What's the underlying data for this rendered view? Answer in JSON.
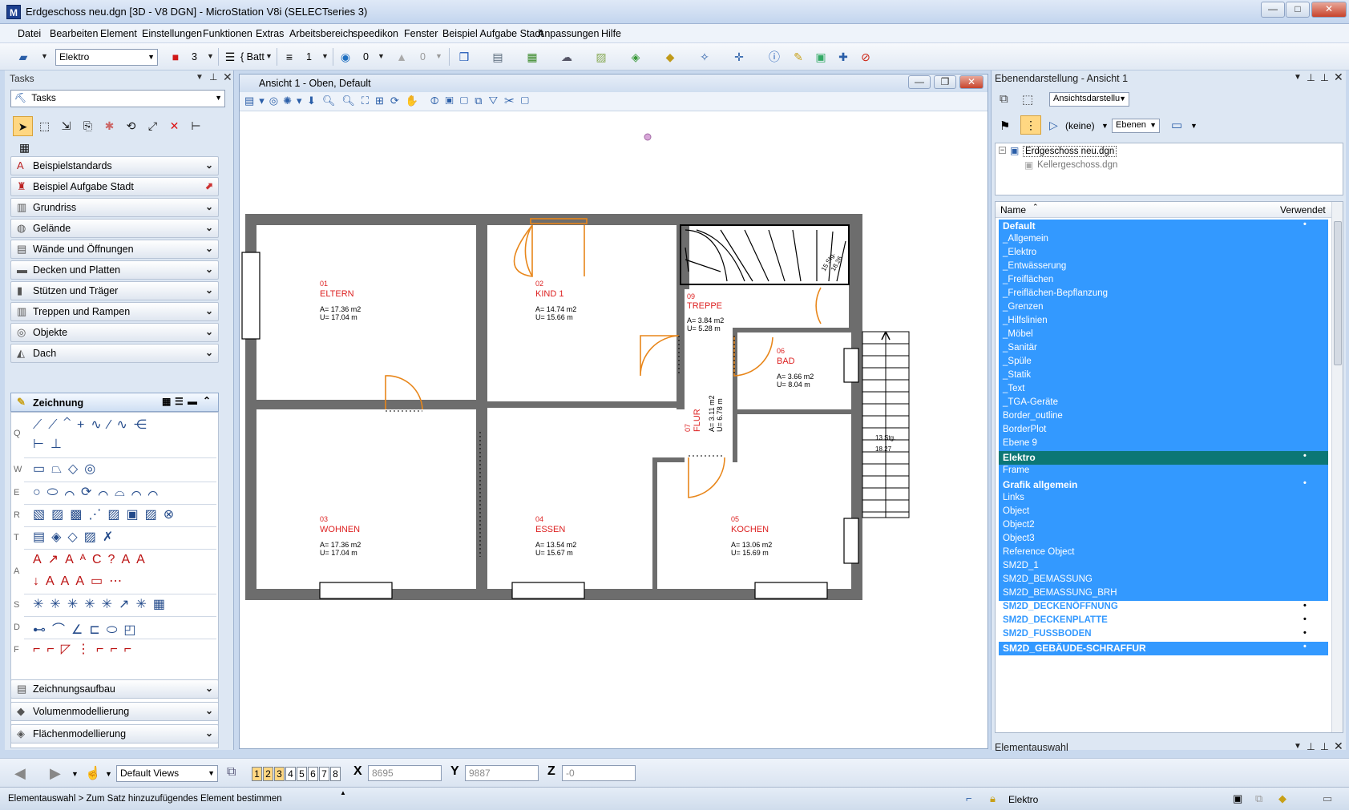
{
  "window": {
    "title": "Erdgeschoss neu.dgn [3D - V8 DGN] - MicroStation V8i (SELECTseries 3)",
    "app_icon": "M",
    "minimize": "—",
    "maximize": "□",
    "close": "✕"
  },
  "menu": [
    "Datei",
    "Bearbeiten",
    "Element",
    "Einstellungen",
    "Funktionen",
    "Extras",
    "Arbeitsbereich",
    "speedikon",
    "Fenster",
    "Beispiel Aufgabe Stadt",
    "Anpassungen",
    "Hilfe"
  ],
  "toolbar": {
    "level": "Elektro",
    "color": "3",
    "style": "{ Batt",
    "weight": "1",
    "transparency": "0",
    "priority": "0"
  },
  "tasks": {
    "title": "Tasks",
    "combo": "Tasks",
    "categories": [
      "Beispielstandards",
      "Beispiel Aufgabe Stadt",
      "Grundriss",
      "Gelände",
      "Wände und Öffnungen",
      "Decken und Platten",
      "Stützen und Träger",
      "Treppen und Rampen",
      "Objekte",
      "Dach"
    ],
    "active": "Zeichnung",
    "row_labels": [
      "Q",
      "W",
      "E",
      "R",
      "T",
      "A",
      "S",
      "D",
      "F"
    ],
    "bottom_categories": [
      "Zeichnungsaufbau",
      "Volumenmodellierung",
      "Flächenmodellierung"
    ]
  },
  "view": {
    "title": "Ansicht 1 - Oben, Default",
    "rooms": [
      {
        "num": "01",
        "name": "ELTERN",
        "area": "A= 17.36 m2",
        "perim": "U= 17.04 m"
      },
      {
        "num": "02",
        "name": "KIND 1",
        "area": "A= 14.74 m2",
        "perim": "U= 15.66 m"
      },
      {
        "num": "09",
        "name": "TREPPE",
        "area": "A= 3.84 m2",
        "perim": "U= 5.28 m"
      },
      {
        "num": "06",
        "name": "BAD",
        "area": "A= 3.66 m2",
        "perim": "U= 8.04 m"
      },
      {
        "num": "07",
        "name": "FLUR",
        "area": "A= 3.11 m2",
        "perim": "U= 6.78 m"
      },
      {
        "num": "03",
        "name": "WOHNEN",
        "area": "A= 17.36 m2",
        "perim": "U= 17.04 m"
      },
      {
        "num": "04",
        "name": "ESSEN",
        "area": "A= 13.54 m2",
        "perim": "U= 15.67 m"
      },
      {
        "num": "05",
        "name": "KOCHEN",
        "area": "A= 13.06 m2",
        "perim": "U= 15.69 m"
      }
    ],
    "stair_labels": [
      "13 Stg.",
      "18.27",
      "15 Stg.",
      "18.26"
    ]
  },
  "layers": {
    "title": "Ebenendarstellung - Ansicht 1",
    "view_combo": "Ansichtsdarstellu",
    "filter": "(keine)",
    "levels_btn": "Ebenen",
    "tree": [
      "Erdgeschoss neu.dgn",
      "Kellergeschoss.dgn"
    ],
    "col_name": "Name",
    "col_used": "Verwendet",
    "rows": [
      {
        "name": "Default",
        "style": "b",
        "used": "•"
      },
      {
        "name": "_Allgemein",
        "style": "n",
        "used": ""
      },
      {
        "name": "_Elektro",
        "style": "n",
        "used": ""
      },
      {
        "name": "_Entwässerung",
        "style": "n",
        "used": ""
      },
      {
        "name": "_Freiflächen",
        "style": "n",
        "used": ""
      },
      {
        "name": "_Freiflächen-Bepflanzung",
        "style": "n",
        "used": ""
      },
      {
        "name": "_Grenzen",
        "style": "n",
        "used": ""
      },
      {
        "name": "_Hilfslinien",
        "style": "n",
        "used": ""
      },
      {
        "name": "_Möbel",
        "style": "n",
        "used": ""
      },
      {
        "name": "_Sanitär",
        "style": "n",
        "used": ""
      },
      {
        "name": "_Spüle",
        "style": "n",
        "used": ""
      },
      {
        "name": "_Statik",
        "style": "n",
        "used": ""
      },
      {
        "name": "_Text",
        "style": "n",
        "used": ""
      },
      {
        "name": "_TGA-Geräte",
        "style": "n",
        "used": ""
      },
      {
        "name": "Border_outline",
        "style": "n",
        "used": ""
      },
      {
        "name": "BorderPlot",
        "style": "n",
        "used": ""
      },
      {
        "name": "Ebene 9",
        "style": "n",
        "used": ""
      },
      {
        "name": "Elektro",
        "style": "sel",
        "used": "•"
      },
      {
        "name": "Frame",
        "style": "n",
        "used": ""
      },
      {
        "name": "Grafik allgemein",
        "style": "b",
        "used": "•"
      },
      {
        "name": "Links",
        "style": "n",
        "used": ""
      },
      {
        "name": "Object",
        "style": "n",
        "used": ""
      },
      {
        "name": "Object2",
        "style": "n",
        "used": ""
      },
      {
        "name": "Object3",
        "style": "n",
        "used": ""
      },
      {
        "name": "Reference Object",
        "style": "n",
        "used": ""
      },
      {
        "name": "SM2D_1",
        "style": "n",
        "used": ""
      },
      {
        "name": "SM2D_BEMASSUNG",
        "style": "n",
        "used": ""
      },
      {
        "name": "SM2D_BEMASSUNG_BRH",
        "style": "n",
        "used": ""
      },
      {
        "name": "SM2D_DECKENÖFFNUNG",
        "style": "white",
        "used": "•"
      },
      {
        "name": "SM2D_DECKENPLATTE",
        "style": "white",
        "used": "•"
      },
      {
        "name": "SM2D_FUSSBODEN",
        "style": "white",
        "used": "•"
      },
      {
        "name": "SM2D_GEBÄUDE-SCHRAFFUR",
        "style": "b",
        "used": "•"
      }
    ]
  },
  "element_selection": {
    "title": "Elementauswahl"
  },
  "bottom": {
    "views_combo": "Default Views",
    "view_numbers": [
      "1",
      "2",
      "3",
      "4",
      "5",
      "6",
      "7",
      "8"
    ],
    "x_label": "X",
    "x_value": "8695",
    "y_label": "Y",
    "y_value": "9887",
    "z_label": "Z",
    "z_value": "-0"
  },
  "status": {
    "message": "Elementauswahl > Zum Satz hinzuzufügendes Element bestimmen",
    "level": "Elektro"
  }
}
